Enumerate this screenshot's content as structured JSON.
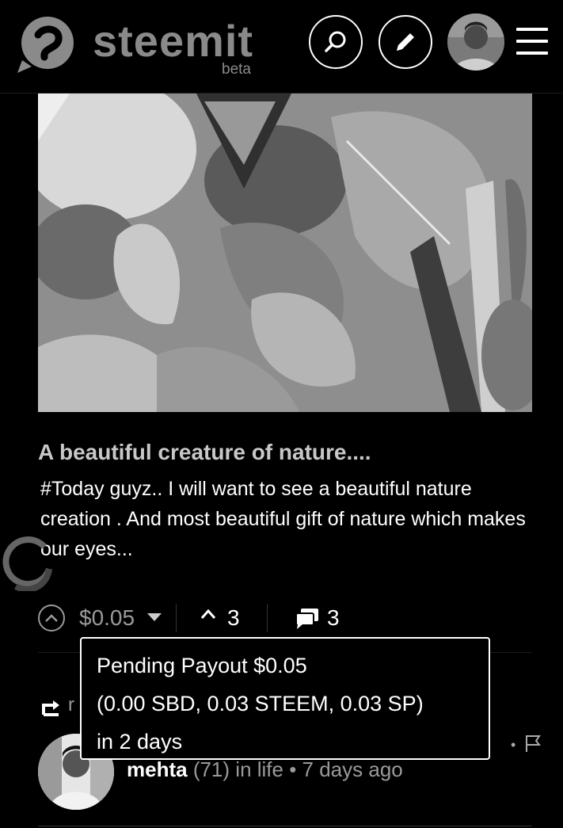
{
  "header": {
    "logo_text": "steemit",
    "logo_sub": "beta",
    "icons": {
      "search": "search-icon",
      "edit": "pencil-icon",
      "menu": "hamburger-menu-icon"
    }
  },
  "post": {
    "title": "A beautiful creature of nature....",
    "excerpt": "#Today guyz.. I will want to see a beautiful nature creation . And most beautiful gift of nature which makes our eyes...",
    "payout": "$0.05",
    "votes": "3",
    "comments": "3"
  },
  "tooltip": {
    "line1": "Pending Payout $0.05",
    "line2": "(0.00 SBD, 0.03 STEEM, 0.03 SP)",
    "line3": "in 2 days"
  },
  "resteem": {
    "label_visible": "r"
  },
  "author": {
    "name": "mehta",
    "reputation": "(71)",
    "meta": " in life • 7 days ago"
  },
  "colors": {
    "background": "#000000",
    "text": "#ffffff",
    "muted": "#9a9a9a",
    "logo": "#8a8a8a"
  }
}
